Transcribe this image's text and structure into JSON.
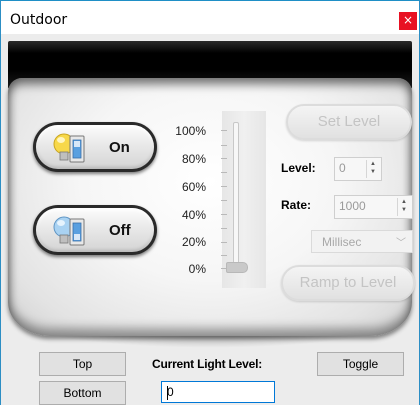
{
  "window": {
    "title": "Outdoor",
    "close_glyph": "×"
  },
  "buttons": {
    "on_label": "On",
    "off_label": "Off",
    "on_icon": "lightbulb-on-icon",
    "off_icon": "lightbulb-off-icon"
  },
  "slider": {
    "scale": [
      "100%",
      "80%",
      "60%",
      "40%",
      "20%",
      "0%"
    ],
    "value_percent": 0
  },
  "controls": {
    "set_level_label": "Set Level",
    "level_label": "Level:",
    "level_value": "0",
    "rate_label": "Rate:",
    "rate_value": "1000",
    "unit_selected": "Millisec",
    "ramp_label": "Ramp to Level"
  },
  "bottom": {
    "top_label": "Top",
    "bottom_label": "Bottom",
    "current_level_label": "Current Light Level:",
    "current_level_value": "0",
    "toggle_label": "Toggle"
  },
  "colors": {
    "close": "#e81123",
    "accent_border": "#0078d7",
    "disabled_text": "#c4c4c4"
  }
}
